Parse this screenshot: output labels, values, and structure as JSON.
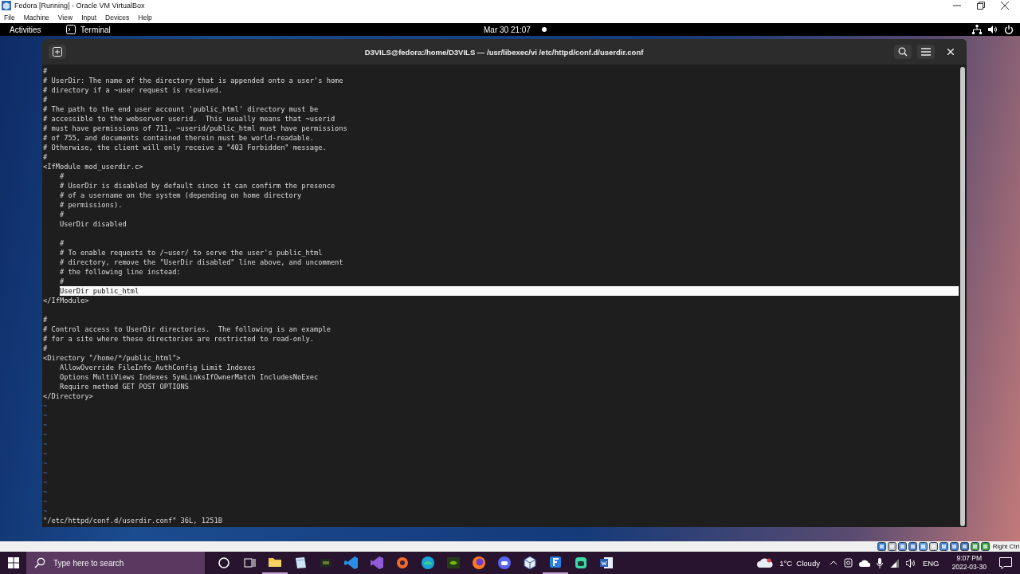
{
  "vbox_window": {
    "title": "Fedora [Running] - Oracle VM VirtualBox",
    "menu": [
      "File",
      "Machine",
      "View",
      "Input",
      "Devices",
      "Help"
    ],
    "host_key": "Right Ctrl"
  },
  "gnome_bar": {
    "activities": "Activities",
    "app": "Terminal",
    "clock": "Mar 30  21:07"
  },
  "terminal": {
    "title": "D3VILS@fedora:/home/D3VILS — /usr/libexec/vi /etc/httpd/conf.d/userdir.conf",
    "lines": [
      {
        "kind": "text",
        "text": "#",
        "selected": false
      },
      {
        "kind": "text",
        "text": "# UserDir: The name of the directory that is appended onto a user's home",
        "selected": false
      },
      {
        "kind": "text",
        "text": "# directory if a ~user request is received.",
        "selected": false
      },
      {
        "kind": "text",
        "text": "#",
        "selected": false
      },
      {
        "kind": "text",
        "text": "# The path to the end user account 'public_html' directory must be",
        "selected": false
      },
      {
        "kind": "text",
        "text": "# accessible to the webserver userid.  This usually means that ~userid",
        "selected": false
      },
      {
        "kind": "text",
        "text": "# must have permissions of 711, ~userid/public_html must have permissions",
        "selected": false
      },
      {
        "kind": "text",
        "text": "# of 755, and documents contained therein must be world-readable.",
        "selected": false
      },
      {
        "kind": "text",
        "text": "# Otherwise, the client will only receive a \"403 Forbidden\" message.",
        "selected": false
      },
      {
        "kind": "text",
        "text": "#",
        "selected": false
      },
      {
        "kind": "text",
        "text": "<IfModule mod_userdir.c>",
        "selected": false
      },
      {
        "kind": "text",
        "text": "    #",
        "selected": false
      },
      {
        "kind": "text",
        "text": "    # UserDir is disabled by default since it can confirm the presence",
        "selected": false
      },
      {
        "kind": "text",
        "text": "    # of a username on the system (depending on home directory",
        "selected": false
      },
      {
        "kind": "text",
        "text": "    # permissions).",
        "selected": false
      },
      {
        "kind": "text",
        "text": "    #",
        "selected": false
      },
      {
        "kind": "text",
        "text": "    UserDir disabled",
        "selected": false
      },
      {
        "kind": "blank"
      },
      {
        "kind": "text",
        "text": "    #",
        "selected": false
      },
      {
        "kind": "text",
        "text": "    # To enable requests to /~user/ to serve the user's public_html",
        "selected": false
      },
      {
        "kind": "text",
        "text": "    # directory, remove the \"UserDir disabled\" line above, and uncomment",
        "selected": false
      },
      {
        "kind": "text",
        "text": "    # the following line instead:",
        "selected": false
      },
      {
        "kind": "text",
        "text": "    #",
        "selected": false
      },
      {
        "kind": "text",
        "text": "    UserDir public_html",
        "selected": true
      },
      {
        "kind": "text",
        "text": "</IfModule>",
        "selected": false
      },
      {
        "kind": "blank"
      },
      {
        "kind": "text",
        "text": "#",
        "selected": false
      },
      {
        "kind": "text",
        "text": "# Control access to UserDir directories.  The following is an example",
        "selected": false
      },
      {
        "kind": "text",
        "text": "# for a site where these directories are restricted to read-only.",
        "selected": false
      },
      {
        "kind": "text",
        "text": "#",
        "selected": false
      },
      {
        "kind": "text",
        "text": "<Directory \"/home/*/public_html\">",
        "selected": false
      },
      {
        "kind": "text",
        "text": "    AllowOverride FileInfo AuthConfig Limit Indexes",
        "selected": false
      },
      {
        "kind": "text",
        "text": "    Options MultiViews Indexes SymLinksIfOwnerMatch IncludesNoExec",
        "selected": false
      },
      {
        "kind": "text",
        "text": "    Require method GET POST OPTIONS",
        "selected": false
      },
      {
        "kind": "text",
        "text": "</Directory>",
        "selected": false
      },
      {
        "kind": "filler",
        "text": "~"
      },
      {
        "kind": "filler",
        "text": "~"
      },
      {
        "kind": "filler",
        "text": "~"
      },
      {
        "kind": "filler",
        "text": "~"
      },
      {
        "kind": "filler",
        "text": "~"
      },
      {
        "kind": "filler",
        "text": "~"
      },
      {
        "kind": "filler",
        "text": "~"
      },
      {
        "kind": "filler",
        "text": "~"
      },
      {
        "kind": "filler",
        "text": "~"
      },
      {
        "kind": "filler",
        "text": "~"
      },
      {
        "kind": "filler",
        "text": "~"
      },
      {
        "kind": "filler",
        "text": "~"
      }
    ],
    "status_line": "\"/etc/httpd/conf.d/userdir.conf\" 36L, 1251B"
  },
  "taskbar": {
    "search_placeholder": "Type here to search",
    "weather": "1°C  Cloudy",
    "language": "ENG",
    "time": "9:07 PM",
    "date": "2022-03-30"
  }
}
